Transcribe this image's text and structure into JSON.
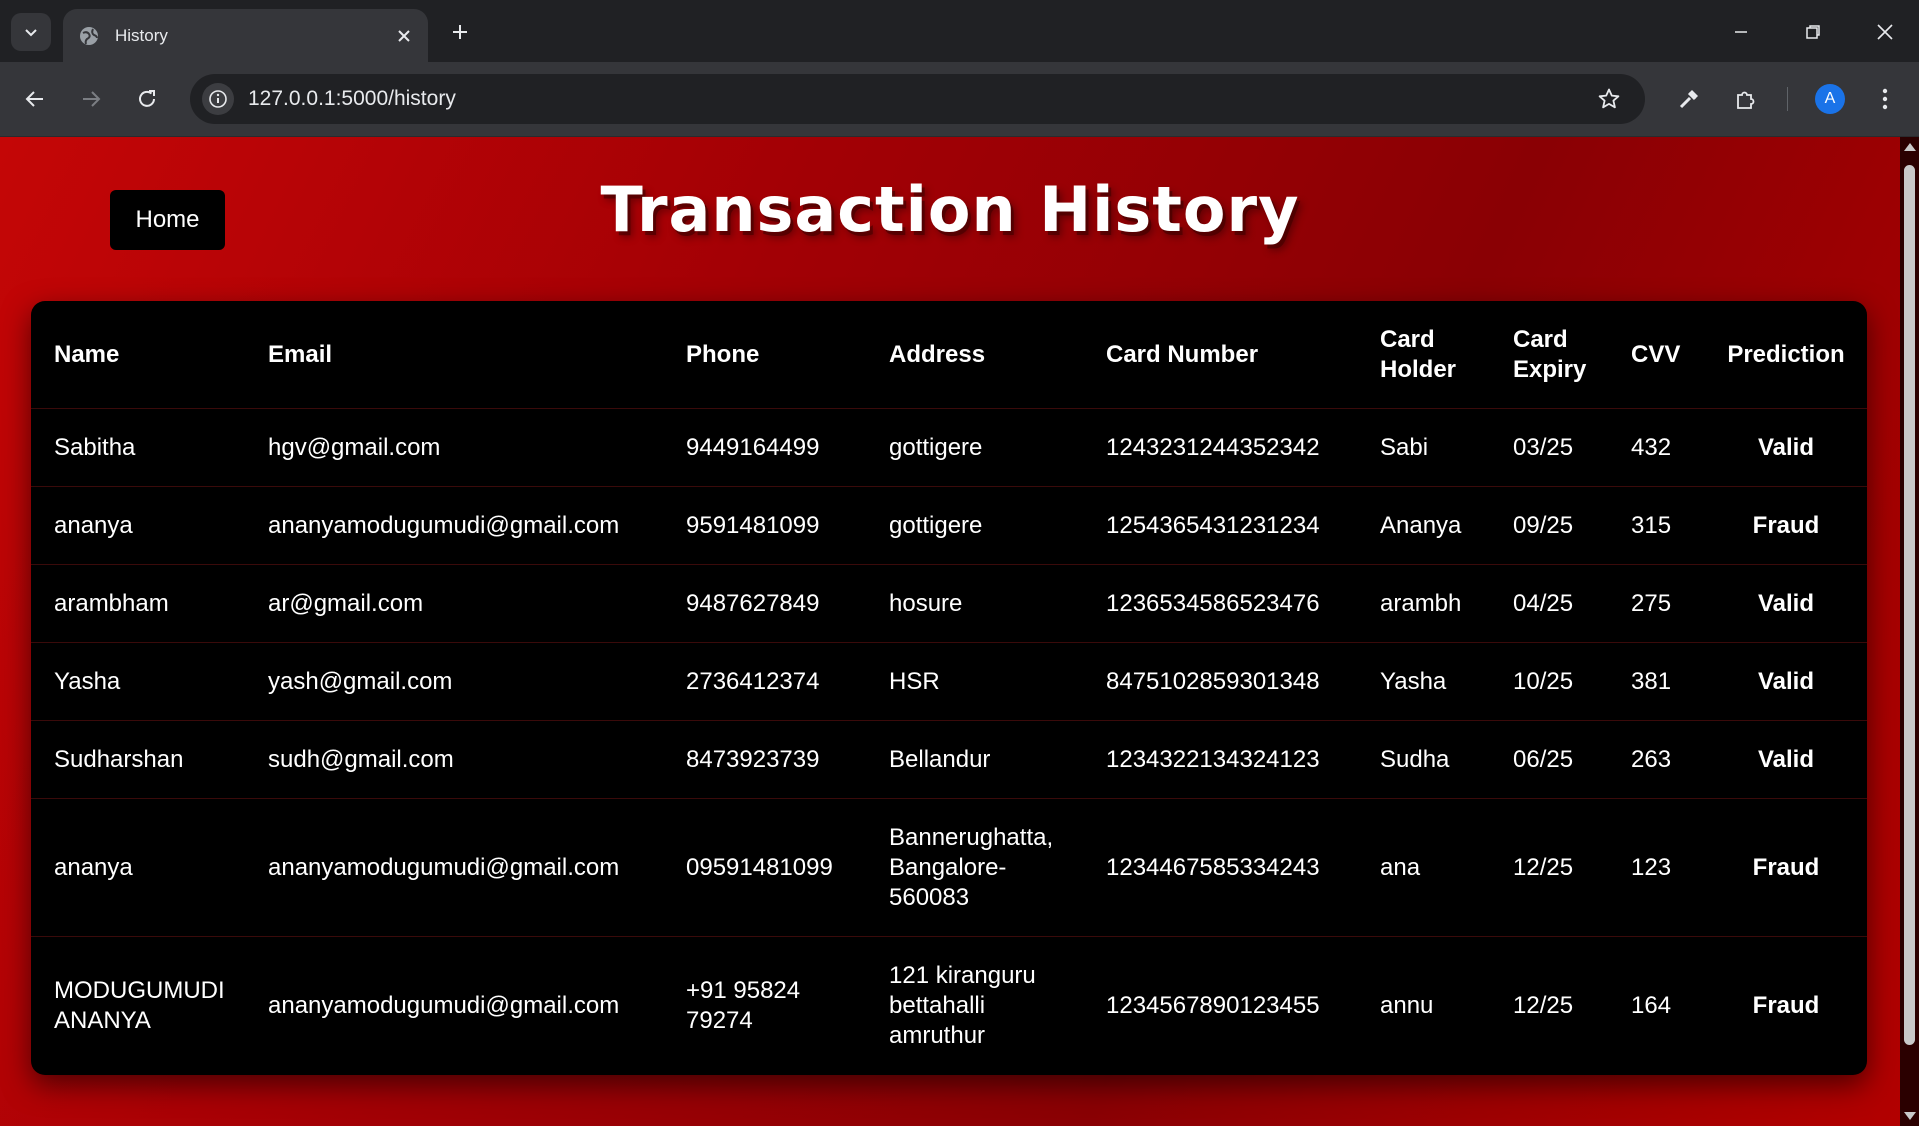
{
  "browser": {
    "tab_title": "History",
    "url": "127.0.0.1:5000/history",
    "profile_initial": "A"
  },
  "page": {
    "home_label": "Home",
    "title": "Transaction History"
  },
  "table": {
    "headers": [
      "Name",
      "Email",
      "Phone",
      "Address",
      "Card Number",
      "Card Holder",
      "Card Expiry",
      "CVV",
      "Prediction"
    ],
    "rows": [
      {
        "name": "Sabitha",
        "email": "hgv@gmail.com",
        "phone": "9449164499",
        "address": "gottigere",
        "card_number": "1243231244352342",
        "card_holder": "Sabi",
        "card_expiry": "03/25",
        "cvv": "432",
        "prediction": "Valid"
      },
      {
        "name": "ananya",
        "email": "ananyamodugumudi@gmail.com",
        "phone": "9591481099",
        "address": "gottigere",
        "card_number": "1254365431231234",
        "card_holder": "Ananya",
        "card_expiry": "09/25",
        "cvv": "315",
        "prediction": "Fraud"
      },
      {
        "name": "arambham",
        "email": "ar@gmail.com",
        "phone": "9487627849",
        "address": "hosure",
        "card_number": "1236534586523476",
        "card_holder": "arambh",
        "card_expiry": "04/25",
        "cvv": "275",
        "prediction": "Valid"
      },
      {
        "name": "Yasha",
        "email": "yash@gmail.com",
        "phone": "2736412374",
        "address": "HSR",
        "card_number": "8475102859301348",
        "card_holder": "Yasha",
        "card_expiry": "10/25",
        "cvv": "381",
        "prediction": "Valid"
      },
      {
        "name": "Sudharshan",
        "email": "sudh@gmail.com",
        "phone": "8473923739",
        "address": "Bellandur",
        "card_number": "1234322134324123",
        "card_holder": "Sudha",
        "card_expiry": "06/25",
        "cvv": "263",
        "prediction": "Valid"
      },
      {
        "name": "ananya",
        "email": "ananyamodugumudi@gmail.com",
        "phone": "09591481099",
        "address": "Bannerughatta, Bangalore-560083",
        "card_number": "1234467585334243",
        "card_holder": "ana",
        "card_expiry": "12/25",
        "cvv": "123",
        "prediction": "Fraud"
      },
      {
        "name": "MODUGUMUDI ANANYA",
        "email": "ananyamodugumudi@gmail.com",
        "phone": "+91 95824 79274",
        "address": "121 kiranguru bettahalli amruthur",
        "card_number": "1234567890123455",
        "card_holder": "annu",
        "card_expiry": "12/25",
        "cvv": "164",
        "prediction": "Fraud"
      }
    ]
  }
}
